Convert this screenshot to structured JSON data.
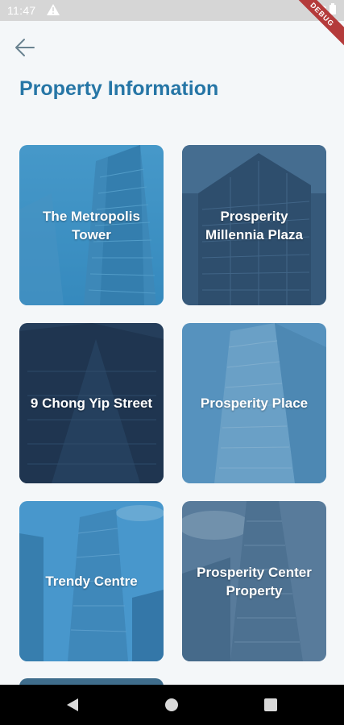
{
  "status_bar": {
    "time": "11:47",
    "debug_label": "DEBUG"
  },
  "header": {
    "back_icon": "arrow-left-icon",
    "title": "Property Information"
  },
  "properties": [
    {
      "name": "The Metropolis Tower",
      "tint": "#2f84b8"
    },
    {
      "name": "Prosperity Millennia Plaza",
      "tint": "#2d4f70"
    },
    {
      "name": "9 Chong Yip Street",
      "tint": "#1f3650"
    },
    {
      "name": "Prosperity Place",
      "tint": "#3d7fad"
    },
    {
      "name": "Trendy Centre",
      "tint": "#2c7db3"
    },
    {
      "name": "Prosperity Center Property",
      "tint": "#3e6385"
    }
  ],
  "nav_bar": {
    "icons": [
      "back-triangle-icon",
      "home-circle-icon",
      "recents-square-icon"
    ]
  },
  "colors": {
    "accent": "#2676a6",
    "background": "#f4f7f9"
  }
}
